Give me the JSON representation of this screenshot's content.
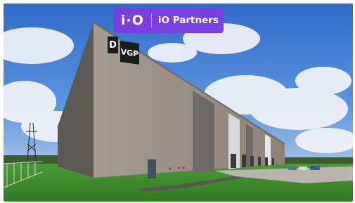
{
  "badge": {
    "logo": "i·O",
    "name": "iO Partners",
    "color": "#7a3fe0"
  },
  "building": {
    "sign_left": "D",
    "sign_right": "VGP"
  },
  "colors": {
    "sky": "#3f7fd6",
    "grass": "#3f8f2e",
    "facade": "#9a8f86",
    "wall_dark": "#5e5b58"
  }
}
